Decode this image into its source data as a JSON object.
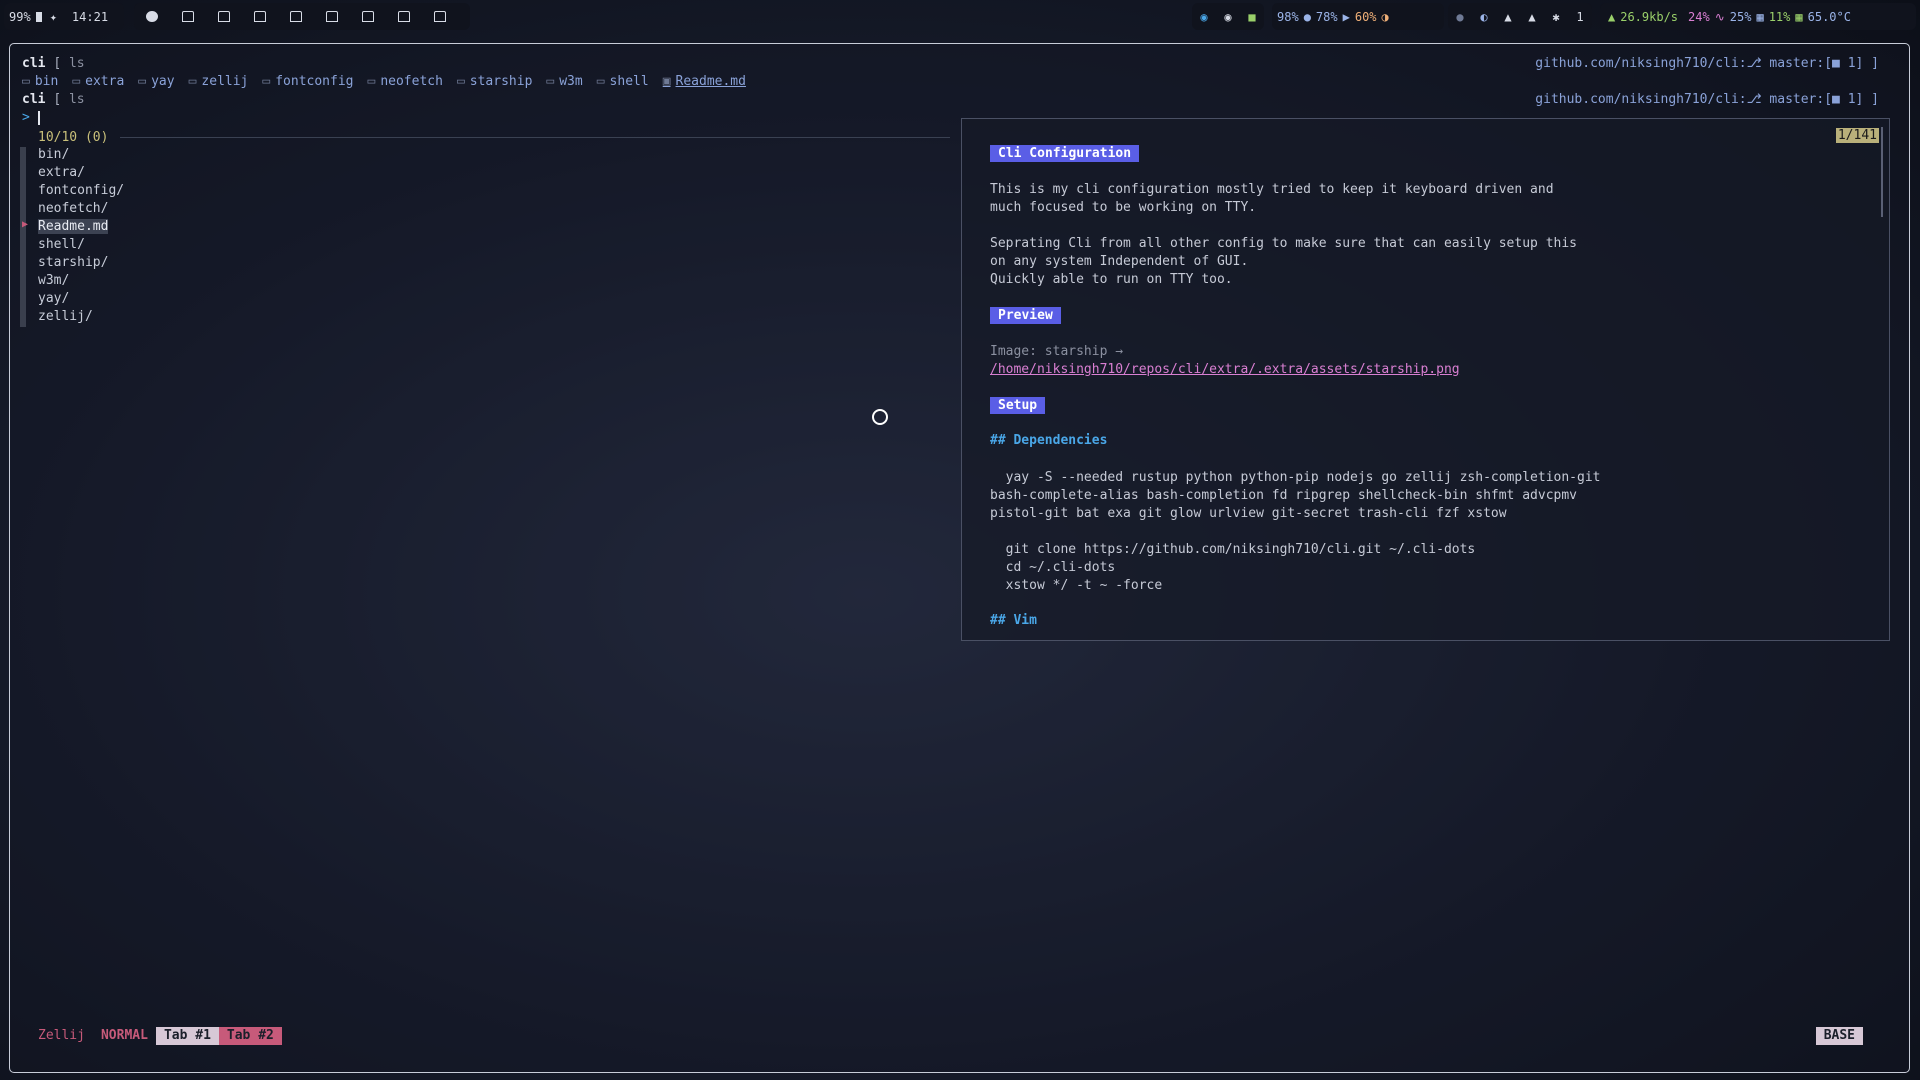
{
  "topbar": {
    "battery": "99%",
    "clock": "14:21",
    "stats": [
      "98%",
      "78%",
      "60%"
    ],
    "notif": "1",
    "net": "26.9kb/s",
    "cpu": "24%",
    "mem": "25%",
    "disk": "11%",
    "temp": "65.0°C"
  },
  "shell": {
    "prompt_dir": "cli",
    "prompt_bracket": "[",
    "cmd": "ls",
    "ls_items": [
      "bin",
      "extra",
      "yay",
      "zellij",
      "fontconfig",
      "neofetch",
      "starship",
      "w3m",
      "shell",
      "Readme.md"
    ],
    "git_status": "github.com/niksingh710/cli:⎇ master:[■ 1] ]",
    "input_prompt": ">"
  },
  "fzf": {
    "count": "10/10 (0)",
    "items": [
      "bin/",
      "extra/",
      "fontconfig/",
      "neofetch/",
      "Readme.md",
      "shell/",
      "starship/",
      "w3m/",
      "yay/",
      "zellij/"
    ],
    "selected": "Readme.md"
  },
  "preview": {
    "counter": "1/141",
    "title": "Cli Configuration",
    "intro_1": "This is my cli configuration mostly tried to keep it keyboard driven and",
    "intro_2": "much focused to be working on TTY.",
    "intro_3": "Seprating Cli from all other config to make sure that can easily setup this",
    "intro_4": "on any system Independent of GUI.",
    "intro_5": "Quickly able to run on TTY too.",
    "preview_heading": "Preview",
    "image_label": "Image: starship →",
    "image_path": "/home/niksingh710/repos/cli/extra/.extra/assets/starship.png",
    "setup_heading": "Setup",
    "deps_heading": "## Dependencies",
    "cmd_1": "  yay -S --needed rustup python python-pip nodejs go zellij zsh-completion-git",
    "cmd_2": "bash-complete-alias bash-completion fd ripgrep shellcheck-bin shfmt advcpmv",
    "cmd_3": "pistol-git bat exa git glow urlview git-secret trash-cli fzf xstow",
    "cmd_4": "  git clone https://github.com/niksingh710/cli.git ~/.cli-dots",
    "cmd_5": "  cd ~/.cli-dots",
    "cmd_6": "  xstow */ -t ~ -force",
    "vim_heading": "## Vim"
  },
  "statusbar": {
    "app": "Zellij",
    "mode": "NORMAL",
    "tab1": "Tab #1",
    "tab2": "Tab #2",
    "base": "BASE"
  },
  "colors": {
    "accent": "#5a5ee6",
    "link": "#d97fd2",
    "heading": "#4aa7e8",
    "mode": "#c75a7a"
  }
}
